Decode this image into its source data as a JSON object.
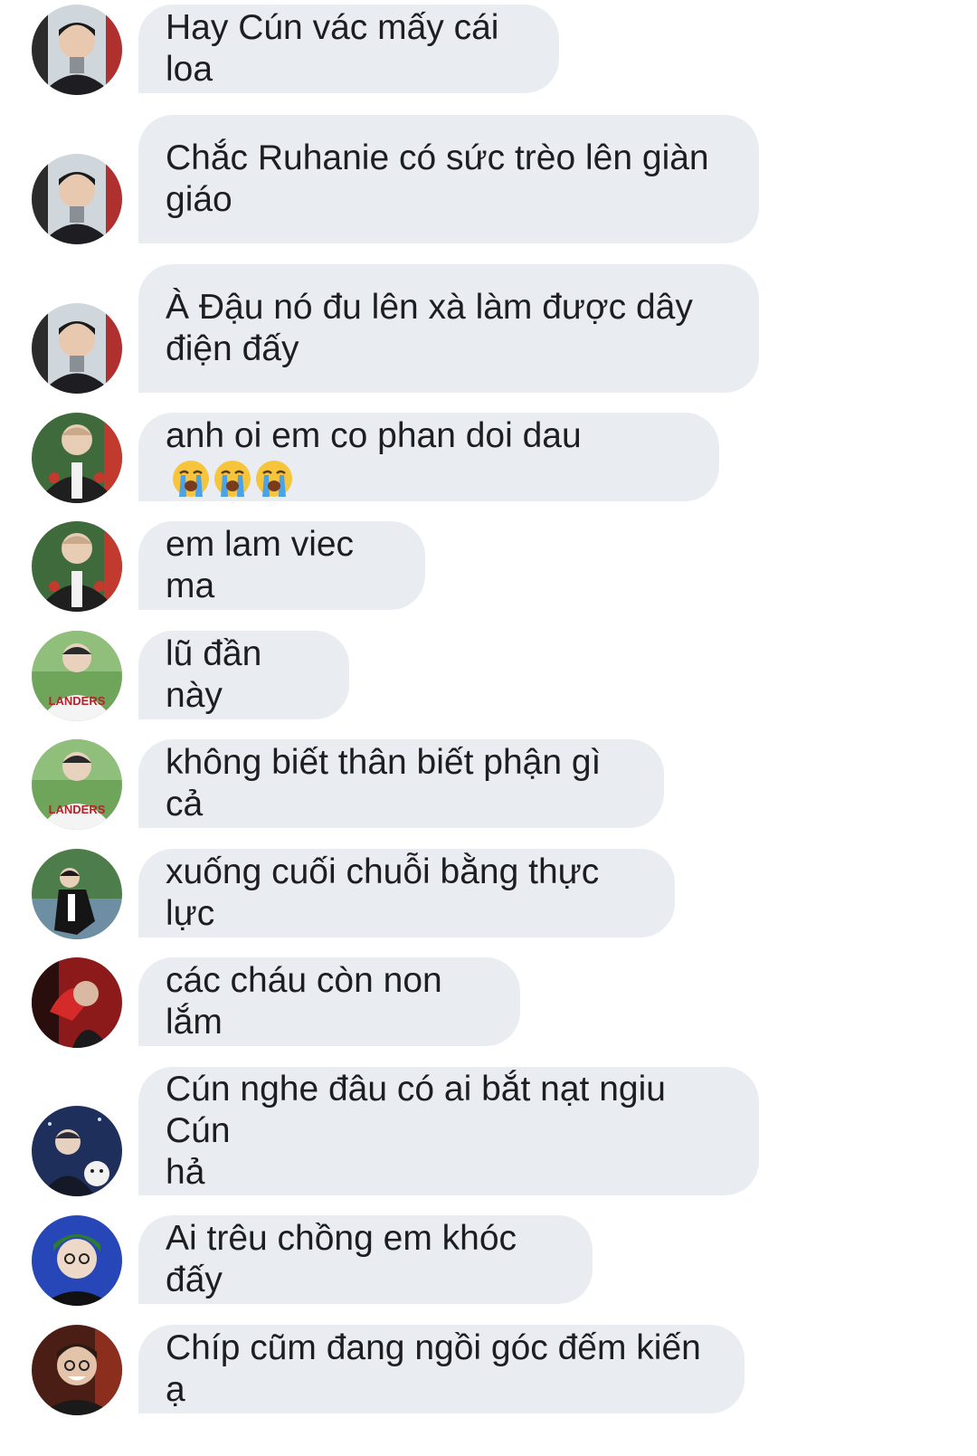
{
  "messages": [
    {
      "text": "Hay Cún vác mấy cái loa",
      "avatar": "avatar-suit-man"
    },
    {
      "text": "Chắc Ruhanie có sức trèo lên giàn\ngiáo",
      "avatar": "avatar-suit-man"
    },
    {
      "text": "À Đậu nó đu lên xà làm được dây\nđiện đấy",
      "avatar": "avatar-suit-man"
    },
    {
      "text": "anh oi em co phan doi dau ",
      "avatar": "avatar-varsity-jacket",
      "emojis": [
        "loudly-crying-face-icon",
        "loudly-crying-face-icon",
        "loudly-crying-face-icon"
      ]
    },
    {
      "text": "em lam viec ma",
      "avatar": "avatar-varsity-jacket"
    },
    {
      "text": "lũ đần này",
      "avatar": "avatar-baseball-jersey"
    },
    {
      "text": "không biết thân biết phận gì cả",
      "avatar": "avatar-baseball-jersey"
    },
    {
      "text": "xuống cuối chuỗi bằng thực lực",
      "avatar": "avatar-outdoor-sitting"
    },
    {
      "text": "các cháu còn non lắm",
      "avatar": "avatar-red-fan"
    },
    {
      "text": "Cún nghe đâu có ai bắt nạt ngiu Cún\nhả",
      "avatar": "avatar-night-puppy"
    },
    {
      "text": "Ai trêu chồng em khóc đấy",
      "avatar": "avatar-green-hat"
    },
    {
      "text": "Chíp cũm đang ngồi góc đếm kiến ạ",
      "avatar": "avatar-laughing-man"
    }
  ],
  "colors": {
    "bubble": "#e9edf2",
    "text": "#1c1e21"
  }
}
